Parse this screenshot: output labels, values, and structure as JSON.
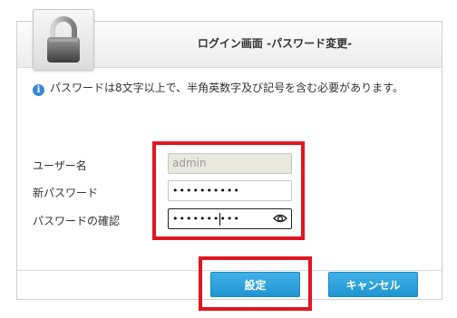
{
  "dialog": {
    "title": "ログイン画面 -パスワード変更-",
    "info_icon_glyph": "i",
    "info_text": "パスワードは8文字以上で、半角英数字及び記号を含む必要があります。"
  },
  "form": {
    "username_label": "ユーザー名",
    "username_value": "admin",
    "new_password_label": "新パスワード",
    "new_password_value": "••••••••••",
    "confirm_password_label": "パスワードの確認",
    "confirm_password_value": "••••••••••"
  },
  "buttons": {
    "save_label": "設定",
    "cancel_label": "キャンセル"
  },
  "colors": {
    "accent": "#2a9fd8",
    "highlight": "#e0161f",
    "info": "#3b86d6"
  },
  "icons": [
    "lock-icon",
    "info-icon",
    "eye-icon"
  ]
}
